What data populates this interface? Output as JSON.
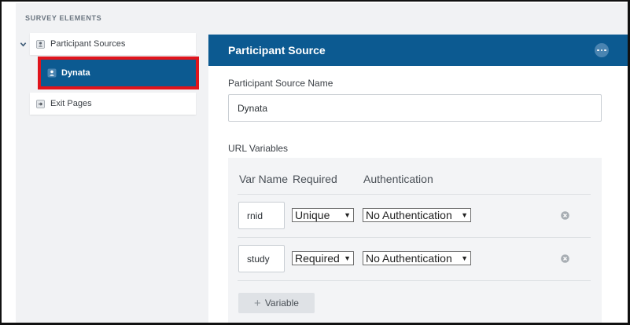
{
  "sidebar": {
    "section_title": "SURVEY ELEMENTS",
    "items": [
      {
        "label": "Participant Sources",
        "icon": "participant-sources-icon",
        "expanded": true
      },
      {
        "label": "Dynata",
        "icon": "participant-source-icon",
        "selected": true
      },
      {
        "label": "Exit Pages",
        "icon": "exit-page-icon"
      }
    ]
  },
  "panel": {
    "title": "Participant Source",
    "menu_icon": "more-options-icon",
    "name_label": "Participant Source Name",
    "name_value": "Dynata",
    "url_vars_label": "URL Variables",
    "columns": [
      "Var Name",
      "Required",
      "Authentication"
    ],
    "rows": [
      {
        "var_name": "rnid",
        "required": "Unique",
        "authentication": "No Authentication"
      },
      {
        "var_name": "study",
        "required": "Required",
        "authentication": "No Authentication"
      }
    ],
    "add_variable_label": "Variable"
  },
  "colors": {
    "header_blue": "#0c5a91",
    "highlight_red": "#e0141c",
    "background": "#f1f2f4"
  }
}
